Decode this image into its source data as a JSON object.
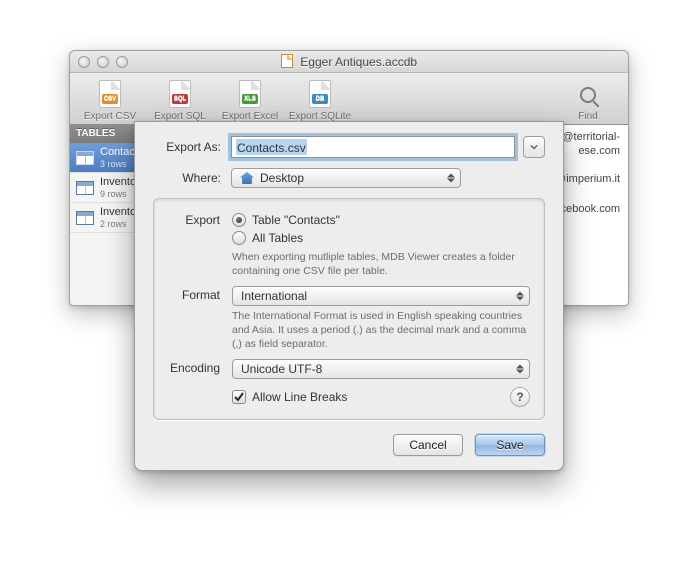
{
  "window": {
    "title": "Egger Antiques.accdb"
  },
  "toolbar": {
    "export_csv": "Export CSV",
    "export_sql": "Export SQL",
    "export_excel": "Export Excel",
    "export_sqlite": "Export SQLite",
    "find": "Find",
    "csv_badge": "CSV",
    "sql_badge": "SQL",
    "xls_badge": "XLS",
    "db_badge": "DB"
  },
  "sidebar": {
    "header": "TABLES",
    "items": [
      {
        "name": "Contacts",
        "sub": "3 rows"
      },
      {
        "name": "Inventory",
        "sub": "9 rows"
      },
      {
        "name": "Inventory",
        "sub": "2 rows"
      }
    ]
  },
  "content_peek": {
    "email1": "ens@territorial-",
    "email2": "ese.com",
    "email3": "@imperium.it",
    "email4": "acebook.com"
  },
  "sheet": {
    "export_as_label": "Export As:",
    "export_as_value": "Contacts.csv",
    "where_label": "Where:",
    "where_value": "Desktop",
    "export_label": "Export",
    "radio_table": "Table \"Contacts\"",
    "radio_all": "All Tables",
    "export_hint": "When exporting mutliple tables, MDB Viewer creates a folder containing one CSV file per table.",
    "format_label": "Format",
    "format_value": "International",
    "format_hint": "The International Format is used in English speaking countries and Asia. It uses a period (.) as the decimal mark and a comma (,) as field separator.",
    "encoding_label": "Encoding",
    "encoding_value": "Unicode UTF-8",
    "allow_line_breaks": "Allow Line Breaks",
    "help": "?",
    "cancel": "Cancel",
    "save": "Save"
  }
}
